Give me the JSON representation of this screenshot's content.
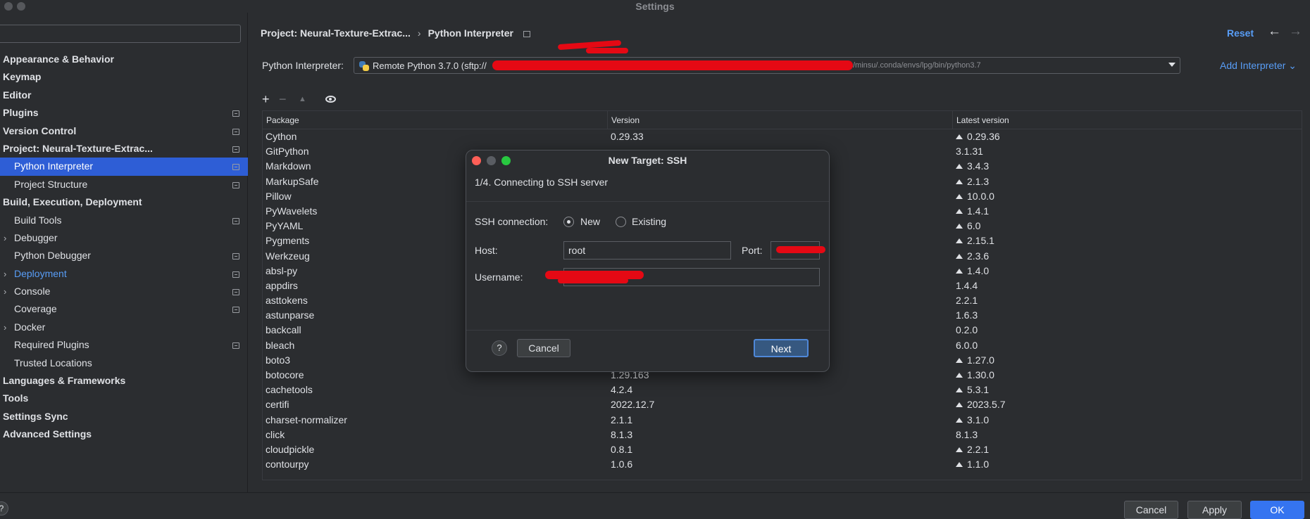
{
  "window": {
    "title": "Settings"
  },
  "search": {
    "value": "",
    "placeholder": ""
  },
  "sidebar": {
    "items": [
      {
        "label": "Appearance & Behavior",
        "bold": true,
        "level": 0,
        "expandable": false,
        "pinned": false,
        "selected": false
      },
      {
        "label": "Keymap",
        "bold": true,
        "level": 0,
        "expandable": false,
        "pinned": false,
        "selected": false
      },
      {
        "label": "Editor",
        "bold": true,
        "level": 0,
        "expandable": false,
        "pinned": false,
        "selected": false
      },
      {
        "label": "Plugins",
        "bold": true,
        "level": 0,
        "expandable": false,
        "pinned": true,
        "selected": false
      },
      {
        "label": "Version Control",
        "bold": true,
        "level": 0,
        "expandable": false,
        "pinned": true,
        "selected": false
      },
      {
        "label": "Project: Neural-Texture-Extrac...",
        "bold": true,
        "level": 0,
        "expandable": false,
        "pinned": true,
        "selected": false
      },
      {
        "label": "Python Interpreter",
        "bold": false,
        "level": 1,
        "expandable": false,
        "pinned": true,
        "selected": true
      },
      {
        "label": "Project Structure",
        "bold": false,
        "level": 1,
        "expandable": false,
        "pinned": true,
        "selected": false
      },
      {
        "label": "Build, Execution, Deployment",
        "bold": true,
        "level": 0,
        "expandable": false,
        "pinned": false,
        "selected": false
      },
      {
        "label": "Build Tools",
        "bold": false,
        "level": 1,
        "expandable": false,
        "pinned": true,
        "selected": false
      },
      {
        "label": "Debugger",
        "bold": false,
        "level": 1,
        "expandable": true,
        "pinned": false,
        "selected": false
      },
      {
        "label": "Python Debugger",
        "bold": false,
        "level": 1,
        "expandable": false,
        "pinned": true,
        "selected": false
      },
      {
        "label": "Deployment",
        "bold": false,
        "level": 1,
        "expandable": true,
        "pinned": true,
        "selected": false,
        "link": true
      },
      {
        "label": "Console",
        "bold": false,
        "level": 1,
        "expandable": true,
        "pinned": true,
        "selected": false
      },
      {
        "label": "Coverage",
        "bold": false,
        "level": 1,
        "expandable": false,
        "pinned": true,
        "selected": false
      },
      {
        "label": "Docker",
        "bold": false,
        "level": 1,
        "expandable": true,
        "pinned": false,
        "selected": false
      },
      {
        "label": "Required Plugins",
        "bold": false,
        "level": 1,
        "expandable": false,
        "pinned": true,
        "selected": false
      },
      {
        "label": "Trusted Locations",
        "bold": false,
        "level": 1,
        "expandable": false,
        "pinned": false,
        "selected": false
      },
      {
        "label": "Languages & Frameworks",
        "bold": true,
        "level": 0,
        "expandable": false,
        "pinned": false,
        "selected": false
      },
      {
        "label": "Tools",
        "bold": true,
        "level": 0,
        "expandable": false,
        "pinned": false,
        "selected": false
      },
      {
        "label": "Settings Sync",
        "bold": true,
        "level": 0,
        "expandable": false,
        "pinned": false,
        "selected": false
      },
      {
        "label": "Advanced Settings",
        "bold": true,
        "level": 0,
        "expandable": false,
        "pinned": false,
        "selected": false
      }
    ]
  },
  "header": {
    "breadcrumb_project": "Project: Neural-Texture-Extrac...",
    "breadcrumb_sep": "›",
    "breadcrumb_page": "Python Interpreter",
    "reset_label": "Reset",
    "back_arrow": "←",
    "forward_arrow": "→"
  },
  "interpreter": {
    "label": "Python Interpreter:",
    "value_prefix": "Remote Python 3.7.0 (sftp://",
    "value_suffix": "/minsu/.conda/envs/lpg/bin/python3.7",
    "add_label": "Add Interpreter",
    "add_chevron": "⌄"
  },
  "toolbar": {
    "add": "+",
    "remove": "−",
    "upgrade": "▲"
  },
  "table": {
    "headers": {
      "package": "Package",
      "version": "Version",
      "latest": "Latest version"
    },
    "rows": [
      {
        "package": "Cython",
        "version": "0.29.33",
        "latest": "0.29.36",
        "upgrade": true
      },
      {
        "package": "GitPython",
        "version": "",
        "latest": "3.1.31",
        "upgrade": false
      },
      {
        "package": "Markdown",
        "version": "",
        "latest": "3.4.3",
        "upgrade": true
      },
      {
        "package": "MarkupSafe",
        "version": "",
        "latest": "2.1.3",
        "upgrade": true
      },
      {
        "package": "Pillow",
        "version": "",
        "latest": "10.0.0",
        "upgrade": true
      },
      {
        "package": "PyWavelets",
        "version": "",
        "latest": "1.4.1",
        "upgrade": true
      },
      {
        "package": "PyYAML",
        "version": "",
        "latest": "6.0",
        "upgrade": true
      },
      {
        "package": "Pygments",
        "version": "",
        "latest": "2.15.1",
        "upgrade": true
      },
      {
        "package": "Werkzeug",
        "version": "",
        "latest": "2.3.6",
        "upgrade": true
      },
      {
        "package": "absl-py",
        "version": "",
        "latest": "1.4.0",
        "upgrade": true
      },
      {
        "package": "appdirs",
        "version": "",
        "latest": "1.4.4",
        "upgrade": false
      },
      {
        "package": "asttokens",
        "version": "",
        "latest": "2.2.1",
        "upgrade": false
      },
      {
        "package": "astunparse",
        "version": "",
        "latest": "1.6.3",
        "upgrade": false
      },
      {
        "package": "backcall",
        "version": "",
        "latest": "0.2.0",
        "upgrade": false
      },
      {
        "package": "bleach",
        "version": "",
        "latest": "6.0.0",
        "upgrade": false
      },
      {
        "package": "boto3",
        "version": "",
        "latest": "1.27.0",
        "upgrade": true
      },
      {
        "package": "botocore",
        "version": "1.29.163",
        "latest": "1.30.0",
        "upgrade": true
      },
      {
        "package": "cachetools",
        "version": "4.2.4",
        "latest": "5.3.1",
        "upgrade": true
      },
      {
        "package": "certifi",
        "version": "2022.12.7",
        "latest": "2023.5.7",
        "upgrade": true
      },
      {
        "package": "charset-normalizer",
        "version": "2.1.1",
        "latest": "3.1.0",
        "upgrade": true
      },
      {
        "package": "click",
        "version": "8.1.3",
        "latest": "8.1.3",
        "upgrade": false
      },
      {
        "package": "cloudpickle",
        "version": "0.8.1",
        "latest": "2.2.1",
        "upgrade": true
      },
      {
        "package": "contourpy",
        "version": "1.0.6",
        "latest": "1.1.0",
        "upgrade": true
      }
    ]
  },
  "dialog": {
    "title": "New Target: SSH",
    "step": "1/4. Connecting to SSH server",
    "ssh_connection_label": "SSH connection:",
    "option_new": "New",
    "option_existing": "Existing",
    "host_label": "Host:",
    "host_value": "root",
    "port_label": "Port:",
    "username_label": "Username:",
    "help": "?",
    "cancel": "Cancel",
    "next": "Next"
  },
  "footer": {
    "help": "?",
    "cancel": "Cancel",
    "apply": "Apply",
    "ok": "OK"
  },
  "colors": {
    "accent": "#2e5ed6",
    "link": "#589df6",
    "redaction": "#e50914",
    "primary_button": "#3574f0"
  }
}
